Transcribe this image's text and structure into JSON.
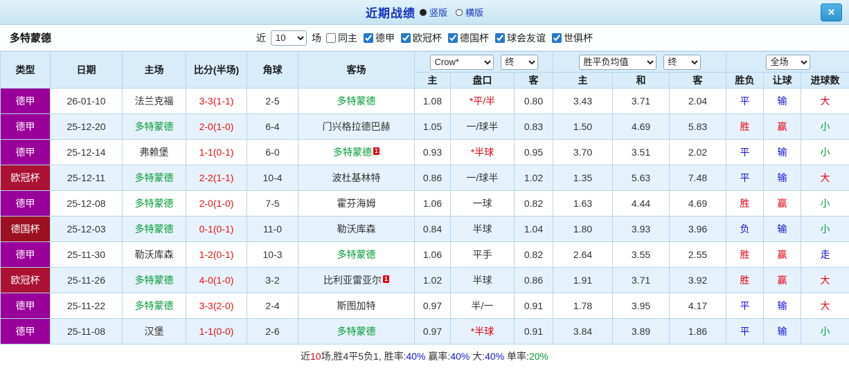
{
  "colors": {
    "red": "#e60012",
    "blue": "#1414d2",
    "green": "#009933",
    "black": "#333333",
    "score": "#ee1111",
    "team": "#009933"
  },
  "league_colors": {
    "德甲": "#990099",
    "欧冠杯": "#aa1133",
    "德国杯": "#9b1122"
  },
  "titlebar": {
    "title": "近期战绩",
    "layout_options": [
      {
        "label": "竖版",
        "selected": true
      },
      {
        "label": "横版",
        "selected": false
      }
    ],
    "close_label": "×"
  },
  "filterbar": {
    "team": "多特蒙德",
    "near_label": "近",
    "match_count": "10",
    "matches_label": "场",
    "checkboxes": [
      {
        "label": "同主",
        "checked": false
      },
      {
        "label": "德甲",
        "checked": true
      },
      {
        "label": "欧冠杯",
        "checked": true
      },
      {
        "label": "德国杯",
        "checked": true
      },
      {
        "label": "球会友谊",
        "checked": true
      },
      {
        "label": "世俱杯",
        "checked": true
      }
    ]
  },
  "table": {
    "main_headers": [
      "类型",
      "日期",
      "主场",
      "比分(半场)",
      "角球",
      "客场"
    ],
    "sub_headers": [
      "主",
      "盘口",
      "客",
      "主",
      "和",
      "客",
      "胜负",
      "让球",
      "进球数"
    ],
    "dropdowns": {
      "bookmaker": "Crow*",
      "bookmaker_period": "终",
      "average": "胜平负均值",
      "average_period": "终",
      "scope": "全场"
    },
    "rows": [
      {
        "league": "德甲",
        "date": "26-01-10",
        "home": {
          "name": "法兰克福",
          "highlight": false,
          "badge": null
        },
        "score": "3-3(1-1)",
        "corners": "2-5",
        "away": {
          "name": "多特蒙德",
          "highlight": true,
          "badge": null
        },
        "odds": {
          "home": "1.08",
          "handicap": "*平/半",
          "handicap_red": true,
          "away": "0.80"
        },
        "avg": {
          "home": "3.43",
          "draw": "3.71",
          "away": "2.04"
        },
        "outcome": {
          "text": "平",
          "color": "blue"
        },
        "handicap_result": {
          "text": "输",
          "color": "blue"
        },
        "goals": {
          "text": "大",
          "color": "red"
        }
      },
      {
        "league": "德甲",
        "date": "25-12-20",
        "home": {
          "name": "多特蒙德",
          "highlight": true,
          "badge": null
        },
        "score": "2-0(1-0)",
        "corners": "6-4",
        "away": {
          "name": "门兴格拉德巴赫",
          "highlight": false,
          "badge": null
        },
        "odds": {
          "home": "1.05",
          "handicap": "一/球半",
          "handicap_red": false,
          "away": "0.83"
        },
        "avg": {
          "home": "1.50",
          "draw": "4.69",
          "away": "5.83"
        },
        "outcome": {
          "text": "胜",
          "color": "red"
        },
        "handicap_result": {
          "text": "赢",
          "color": "red"
        },
        "goals": {
          "text": "小",
          "color": "green"
        }
      },
      {
        "league": "德甲",
        "date": "25-12-14",
        "home": {
          "name": "弗赖堡",
          "highlight": false,
          "badge": null
        },
        "score": "1-1(0-1)",
        "corners": "6-0",
        "away": {
          "name": "多特蒙德",
          "highlight": true,
          "badge": "1"
        },
        "odds": {
          "home": "0.93",
          "handicap": "*半球",
          "handicap_red": true,
          "away": "0.95"
        },
        "avg": {
          "home": "3.70",
          "draw": "3.51",
          "away": "2.02"
        },
        "outcome": {
          "text": "平",
          "color": "blue"
        },
        "handicap_result": {
          "text": "输",
          "color": "blue"
        },
        "goals": {
          "text": "小",
          "color": "green"
        }
      },
      {
        "league": "欧冠杯",
        "date": "25-12-11",
        "home": {
          "name": "多特蒙德",
          "highlight": true,
          "badge": null
        },
        "score": "2-2(1-1)",
        "corners": "10-4",
        "away": {
          "name": "波杜基林特",
          "highlight": false,
          "badge": null
        },
        "odds": {
          "home": "0.86",
          "handicap": "一/球半",
          "handicap_red": false,
          "away": "1.02"
        },
        "avg": {
          "home": "1.35",
          "draw": "5.63",
          "away": "7.48"
        },
        "outcome": {
          "text": "平",
          "color": "blue"
        },
        "handicap_result": {
          "text": "输",
          "color": "blue"
        },
        "goals": {
          "text": "大",
          "color": "red"
        }
      },
      {
        "league": "德甲",
        "date": "25-12-08",
        "home": {
          "name": "多特蒙德",
          "highlight": true,
          "badge": null
        },
        "score": "2-0(1-0)",
        "corners": "7-5",
        "away": {
          "name": "霍芬海姆",
          "highlight": false,
          "badge": null
        },
        "odds": {
          "home": "1.06",
          "handicap": "一球",
          "handicap_red": false,
          "away": "0.82"
        },
        "avg": {
          "home": "1.63",
          "draw": "4.44",
          "away": "4.69"
        },
        "outcome": {
          "text": "胜",
          "color": "red"
        },
        "handicap_result": {
          "text": "赢",
          "color": "red"
        },
        "goals": {
          "text": "小",
          "color": "green"
        }
      },
      {
        "league": "德国杯",
        "date": "25-12-03",
        "home": {
          "name": "多特蒙德",
          "highlight": true,
          "badge": null
        },
        "score": "0-1(0-1)",
        "corners": "11-0",
        "away": {
          "name": "勒沃库森",
          "highlight": false,
          "badge": null
        },
        "odds": {
          "home": "0.84",
          "handicap": "半球",
          "handicap_red": false,
          "away": "1.04"
        },
        "avg": {
          "home": "1.80",
          "draw": "3.93",
          "away": "3.96"
        },
        "outcome": {
          "text": "负",
          "color": "blue"
        },
        "handicap_result": {
          "text": "输",
          "color": "blue"
        },
        "goals": {
          "text": "小",
          "color": "green"
        }
      },
      {
        "league": "德甲",
        "date": "25-11-30",
        "home": {
          "name": "勒沃库森",
          "highlight": false,
          "badge": null
        },
        "score": "1-2(0-1)",
        "corners": "10-3",
        "away": {
          "name": "多特蒙德",
          "highlight": true,
          "badge": null
        },
        "odds": {
          "home": "1.06",
          "handicap": "平手",
          "handicap_red": false,
          "away": "0.82"
        },
        "avg": {
          "home": "2.64",
          "draw": "3.55",
          "away": "2.55"
        },
        "outcome": {
          "text": "胜",
          "color": "red"
        },
        "handicap_result": {
          "text": "赢",
          "color": "red"
        },
        "goals": {
          "text": "走",
          "color": "blue"
        }
      },
      {
        "league": "欧冠杯",
        "date": "25-11-26",
        "home": {
          "name": "多特蒙德",
          "highlight": true,
          "badge": null
        },
        "score": "4-0(1-0)",
        "corners": "3-2",
        "away": {
          "name": "比利亚雷亚尔",
          "highlight": false,
          "badge": "1"
        },
        "odds": {
          "home": "1.02",
          "handicap": "半球",
          "handicap_red": false,
          "away": "0.86"
        },
        "avg": {
          "home": "1.91",
          "draw": "3.71",
          "away": "3.92"
        },
        "outcome": {
          "text": "胜",
          "color": "red"
        },
        "handicap_result": {
          "text": "赢",
          "color": "red"
        },
        "goals": {
          "text": "大",
          "color": "red"
        }
      },
      {
        "league": "德甲",
        "date": "25-11-22",
        "home": {
          "name": "多特蒙德",
          "highlight": true,
          "badge": null
        },
        "score": "3-3(2-0)",
        "corners": "2-4",
        "away": {
          "name": "斯图加特",
          "highlight": false,
          "badge": null
        },
        "odds": {
          "home": "0.97",
          "handicap": "半/一",
          "handicap_red": false,
          "away": "0.91"
        },
        "avg": {
          "home": "1.78",
          "draw": "3.95",
          "away": "4.17"
        },
        "outcome": {
          "text": "平",
          "color": "blue"
        },
        "handicap_result": {
          "text": "输",
          "color": "blue"
        },
        "goals": {
          "text": "大",
          "color": "red"
        }
      },
      {
        "league": "德甲",
        "date": "25-11-08",
        "home": {
          "name": "汉堡",
          "highlight": false,
          "badge": null
        },
        "score": "1-1(0-0)",
        "corners": "2-6",
        "away": {
          "name": "多特蒙德",
          "highlight": true,
          "badge": null
        },
        "odds": {
          "home": "0.97",
          "handicap": "*半球",
          "handicap_red": true,
          "away": "0.91"
        },
        "avg": {
          "home": "3.84",
          "draw": "3.89",
          "away": "1.86"
        },
        "outcome": {
          "text": "平",
          "color": "blue"
        },
        "handicap_result": {
          "text": "输",
          "color": "blue"
        },
        "goals": {
          "text": "小",
          "color": "green"
        }
      }
    ]
  },
  "footer": {
    "segments": [
      {
        "text": "近",
        "color": "black"
      },
      {
        "text": "10",
        "color": "red"
      },
      {
        "text": "场,胜4平5负1, 胜率:",
        "color": "black"
      },
      {
        "text": "40%",
        "color": "blue"
      },
      {
        "text": " 赢率:",
        "color": "black"
      },
      {
        "text": "40%",
        "color": "blue"
      },
      {
        "text": " 大:",
        "color": "black"
      },
      {
        "text": "40%",
        "color": "blue"
      },
      {
        "text": " 单率:",
        "color": "black"
      },
      {
        "text": "20%",
        "color": "green"
      }
    ]
  }
}
